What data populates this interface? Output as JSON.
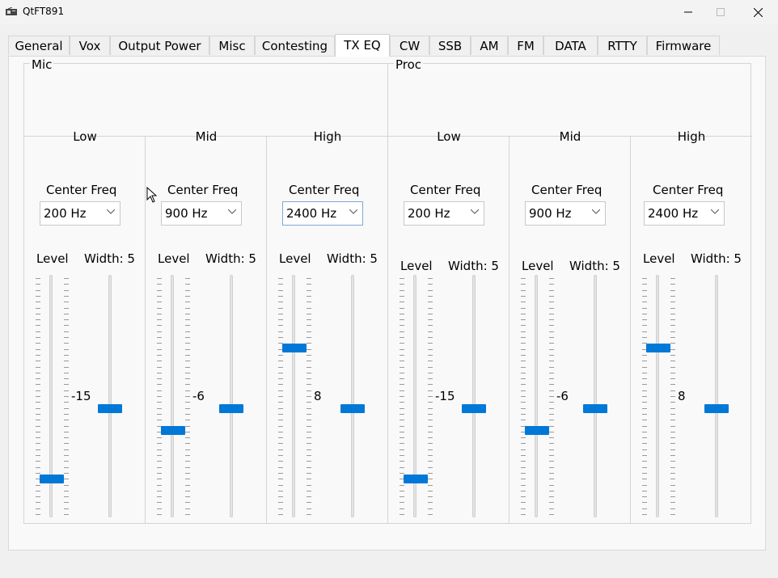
{
  "window": {
    "title": "QtFT891"
  },
  "tabs": [
    "General",
    "Vox",
    "Output Power",
    "Misc",
    "Contesting",
    "TX EQ",
    "CW",
    "SSB",
    "AM",
    "FM",
    "DATA",
    "RTTY",
    "Firmware"
  ],
  "active_tab": "TX EQ",
  "mic": {
    "title": "Mic",
    "bands": [
      {
        "name": "Low",
        "center_label": "Center Freq",
        "freq": "200 Hz",
        "level_label": "Level",
        "width_label": "Width: 5",
        "level_value": "-15",
        "level_fraction": 0.16,
        "width_fraction": 0.45
      },
      {
        "name": "Mid",
        "center_label": "Center Freq",
        "freq": "900 Hz",
        "level_label": "Level",
        "width_label": "Width: 5",
        "level_value": "-6",
        "level_fraction": 0.36,
        "width_fraction": 0.45
      },
      {
        "name": "High",
        "center_label": "Center Freq",
        "freq": "2400 Hz",
        "level_label": "Level",
        "width_label": "Width: 5",
        "level_value": "8",
        "level_fraction": 0.7,
        "width_fraction": 0.45
      }
    ]
  },
  "proc": {
    "title": "Proc",
    "bands": [
      {
        "name": "Low",
        "center_label": "Center Freq",
        "freq": "200 Hz",
        "level_label": "Level",
        "width_label": "Width: 5",
        "level_value": "-15",
        "level_fraction": 0.16,
        "width_fraction": 0.45
      },
      {
        "name": "Mid",
        "center_label": "Center Freq",
        "freq": "900 Hz",
        "level_label": "Level",
        "width_label": "Width: 5",
        "level_value": "-6",
        "level_fraction": 0.36,
        "width_fraction": 0.45
      },
      {
        "name": "High",
        "center_label": "Center Freq",
        "freq": "2400 Hz",
        "level_label": "Level",
        "width_label": "Width: 5",
        "level_value": "8",
        "level_fraction": 0.7,
        "width_fraction": 0.45
      }
    ]
  },
  "colors": {
    "accent": "#0078d7"
  },
  "icons": {
    "app": "radio-icon",
    "minimize": "minimize-icon",
    "maximize": "maximize-icon",
    "close": "close-icon",
    "dropdown": "chevron-down-icon",
    "cursor": "mouse-pointer-icon"
  }
}
